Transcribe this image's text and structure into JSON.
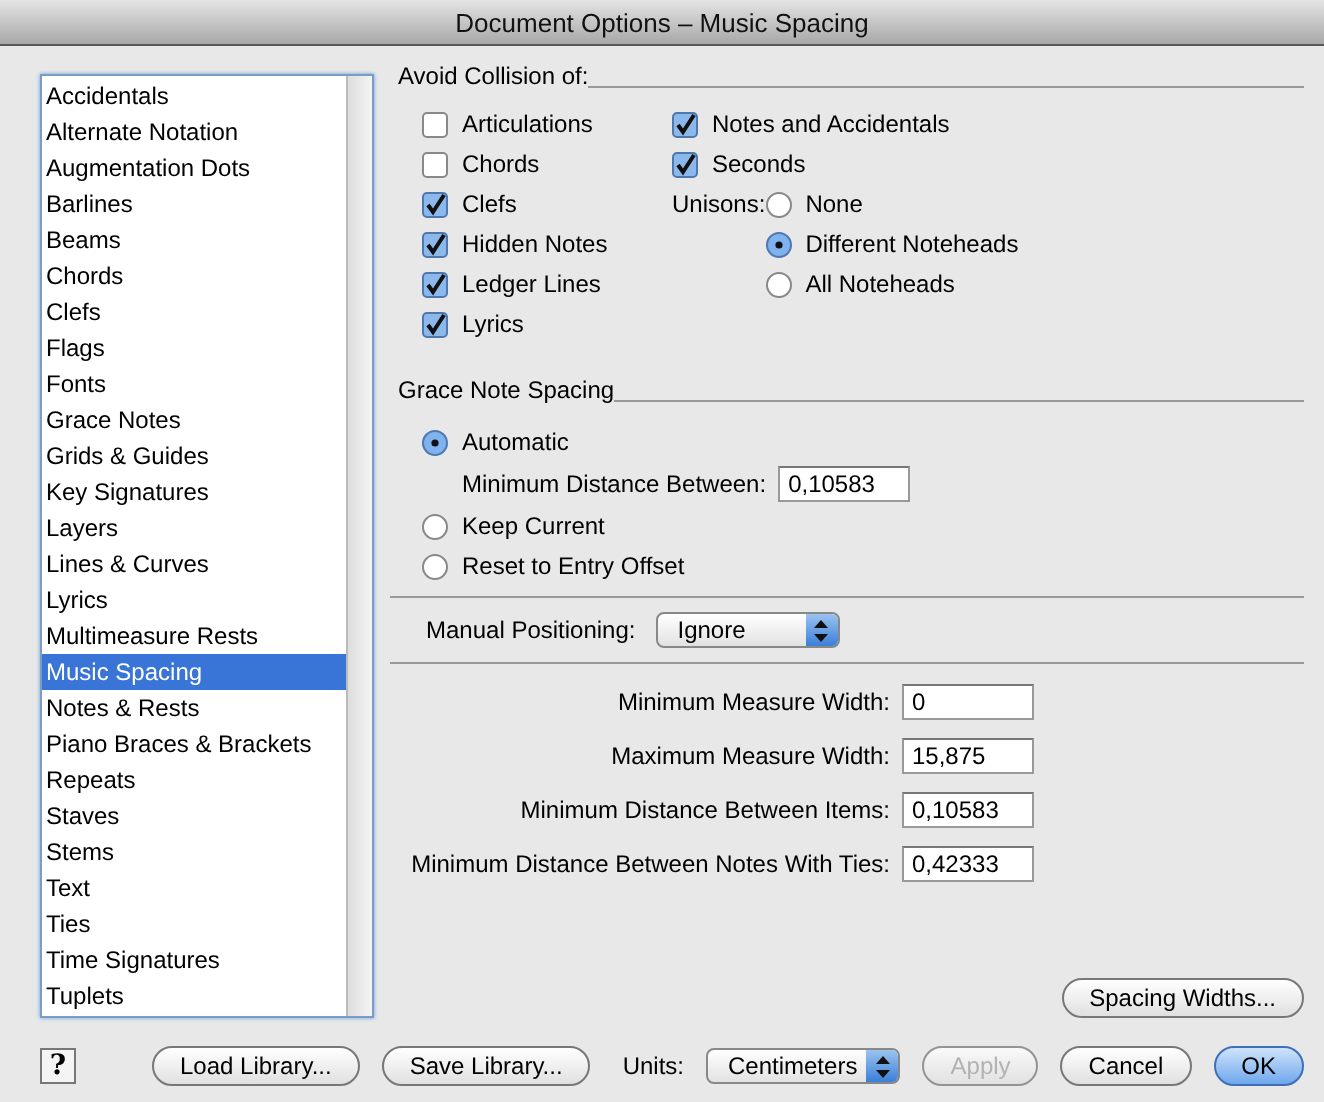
{
  "window": {
    "title": "Document Options – Music Spacing"
  },
  "categories": [
    {
      "label": "Accidentals",
      "selected": false
    },
    {
      "label": "Alternate Notation",
      "selected": false
    },
    {
      "label": "Augmentation Dots",
      "selected": false
    },
    {
      "label": "Barlines",
      "selected": false
    },
    {
      "label": "Beams",
      "selected": false
    },
    {
      "label": "Chords",
      "selected": false
    },
    {
      "label": "Clefs",
      "selected": false
    },
    {
      "label": "Flags",
      "selected": false
    },
    {
      "label": "Fonts",
      "selected": false
    },
    {
      "label": "Grace Notes",
      "selected": false
    },
    {
      "label": "Grids & Guides",
      "selected": false
    },
    {
      "label": "Key Signatures",
      "selected": false
    },
    {
      "label": "Layers",
      "selected": false
    },
    {
      "label": "Lines & Curves",
      "selected": false
    },
    {
      "label": "Lyrics",
      "selected": false
    },
    {
      "label": "Multimeasure Rests",
      "selected": false
    },
    {
      "label": "Music Spacing",
      "selected": true
    },
    {
      "label": "Notes & Rests",
      "selected": false
    },
    {
      "label": "Piano Braces & Brackets",
      "selected": false
    },
    {
      "label": "Repeats",
      "selected": false
    },
    {
      "label": "Staves",
      "selected": false
    },
    {
      "label": "Stems",
      "selected": false
    },
    {
      "label": "Text",
      "selected": false
    },
    {
      "label": "Ties",
      "selected": false
    },
    {
      "label": "Time Signatures",
      "selected": false
    },
    {
      "label": "Tuplets",
      "selected": false
    }
  ],
  "avoid_collision": {
    "heading": "Avoid Collision of:",
    "options_left": [
      {
        "label": "Articulations",
        "checked": false
      },
      {
        "label": "Chords",
        "checked": false
      },
      {
        "label": "Clefs",
        "checked": true
      },
      {
        "label": "Hidden Notes",
        "checked": true
      },
      {
        "label": "Ledger Lines",
        "checked": true
      },
      {
        "label": "Lyrics",
        "checked": true
      }
    ],
    "options_right": [
      {
        "label": "Notes and Accidentals",
        "checked": true
      },
      {
        "label": "Seconds",
        "checked": true
      }
    ],
    "unisons": {
      "label": "Unisons:",
      "options": [
        {
          "label": "None",
          "selected": false
        },
        {
          "label": "Different Noteheads",
          "selected": true
        },
        {
          "label": "All Noteheads",
          "selected": false
        }
      ]
    }
  },
  "grace_note_spacing": {
    "heading": "Grace Note Spacing",
    "options": [
      {
        "label": "Automatic",
        "selected": true
      },
      {
        "label": "Keep Current",
        "selected": false
      },
      {
        "label": "Reset to Entry Offset",
        "selected": false
      }
    ],
    "min_distance": {
      "label": "Minimum Distance Between:",
      "value": "0,10583"
    }
  },
  "manual_positioning": {
    "label": "Manual Positioning:",
    "value": "Ignore"
  },
  "measure_fields": [
    {
      "label": "Minimum Measure Width:",
      "value": "0"
    },
    {
      "label": "Maximum Measure Width:",
      "value": "15,875"
    },
    {
      "label": "Minimum Distance Between Items:",
      "value": "0,10583"
    },
    {
      "label": "Minimum Distance Between Notes With Ties:",
      "value": "0,42333"
    }
  ],
  "spacing_widths_button": {
    "label": "Spacing Widths...",
    "disabled": false,
    "primary": false
  },
  "help_button": "?",
  "footer": {
    "left_buttons": [
      {
        "label": "Load Library...",
        "disabled": false,
        "primary": false
      },
      {
        "label": "Save Library...",
        "disabled": false,
        "primary": false
      }
    ],
    "units": {
      "label": "Units:",
      "value": "Centimeters"
    },
    "right_buttons": [
      {
        "label": "Apply",
        "disabled": true,
        "primary": false
      },
      {
        "label": "Cancel",
        "disabled": false,
        "primary": false
      },
      {
        "label": "OK",
        "disabled": false,
        "primary": true
      }
    ]
  }
}
